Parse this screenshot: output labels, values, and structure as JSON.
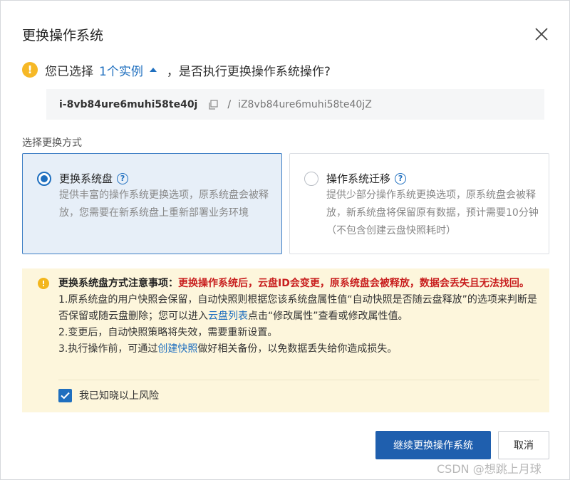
{
  "dialog": {
    "title": "更换操作系统",
    "close_icon": "close-icon"
  },
  "confirm": {
    "prefix": "您已选择",
    "instance_link": "1个实例",
    "suffix": "，是否执行更换操作系统操作?"
  },
  "instance": {
    "id": "i-8vb84ure6muhi58te40j",
    "separator": "/",
    "name": "iZ8vb84ure6muhi58te40jZ"
  },
  "method": {
    "label": "选择更换方式",
    "options": [
      {
        "title": "更换系统盘",
        "help": "?",
        "desc": "提供丰富的操作系统更换选项，原系统盘会被释放，您需要在新系统盘上重新部署业务环境",
        "selected": true
      },
      {
        "title": "操作系统迁移",
        "help": "?",
        "desc": "提供少部分操作系统更换选项，原系统盘会被释放，新系统盘将保留原有数据，预计需要10分钟（不包含创建云盘快照耗时）",
        "selected": false
      }
    ]
  },
  "notice": {
    "title": "更换系统盘方式注意事项：",
    "red": "更换操作系统后，云盘ID会变更，原系统盘会被释放，数据会丢失且无法找回。",
    "line1_a": "1.原系统盘的用户快照会保留，自动快照则根据您该系统盘属性值“自动快照是否随云盘释放”的选项来判断是否保留或随云盘删除；您可以进入",
    "line1_link": "云盘列表",
    "line1_b": "点击“修改属性”查看或修改属性值。",
    "line2": "2.变更后，自动快照策略将失效，需要重新设置。",
    "line3_a": "3.执行操作前，可通过",
    "line3_link": "创建快照",
    "line3_b": "做好相关备份，以免数据丢失给你造成损失。",
    "ack": "我已知晓以上风险",
    "ack_checked": true
  },
  "buttons": {
    "continue": "继续更换操作系统",
    "cancel": "取消"
  },
  "watermark": "CSDN @想跳上月球",
  "colors": {
    "accent": "#1f6fbf",
    "primary_button": "#1f5fae",
    "warning": "#c81e1e",
    "notice_bg": "#fdf6dc"
  }
}
